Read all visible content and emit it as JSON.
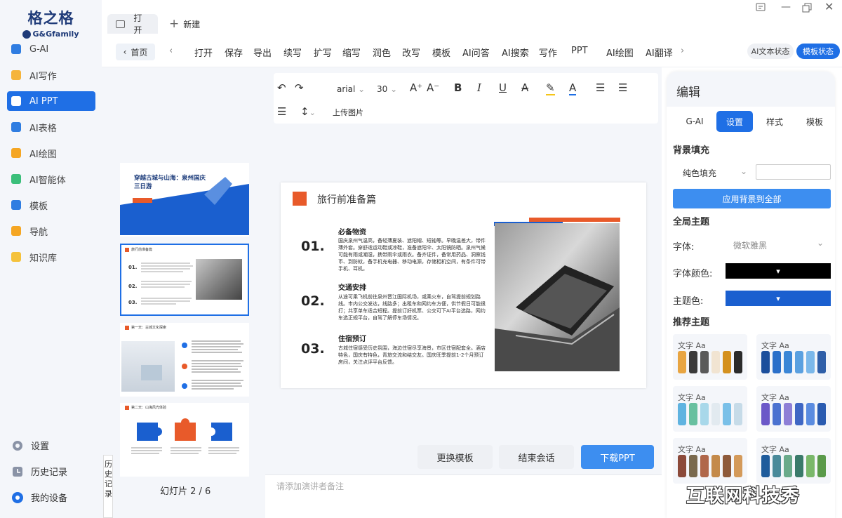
{
  "app": {
    "logo_cn": "格之格",
    "logo_en": "G&Gfamily"
  },
  "sidebar": {
    "items": [
      {
        "label": "G-AI",
        "color": "#2f7de1"
      },
      {
        "label": "AI写作",
        "color": "#f5b43b"
      },
      {
        "label": "AI PPT",
        "color": "#3bbf7a"
      },
      {
        "label": "AI表格",
        "color": "#2f7de1"
      },
      {
        "label": "AI绘图",
        "color": "#f5a623"
      },
      {
        "label": "AI智能体",
        "color": "#3bbf7a"
      },
      {
        "label": "模板",
        "color": "#2f7de1"
      },
      {
        "label": "导航",
        "color": "#f5a623"
      },
      {
        "label": "知识库",
        "color": "#f5c23b"
      }
    ],
    "bottom": {
      "settings": "设置",
      "history": "历史记录",
      "devices": "我的设备"
    }
  },
  "tabs": {
    "open": "打开",
    "new": "新建"
  },
  "toolbar": {
    "home": "首页",
    "items": [
      "打开",
      "保存",
      "导出",
      "续写",
      "扩写",
      "缩写",
      "润色",
      "改写",
      "模板",
      "AI问答",
      "AI搜索",
      "写作",
      "PPT",
      "AI绘图",
      "AI翻译"
    ],
    "status_text": "AI文本状态",
    "status_template": "模板状态"
  },
  "editor": {
    "font": "arial",
    "size": "30",
    "upload": "上传图片",
    "buttons": {
      "change": "更换模板",
      "end": "结束会话",
      "download": "下载PPT"
    },
    "notes_placeholder": "请添加演讲者备注"
  },
  "slides": {
    "counter": "幻灯片 2 / 6",
    "history_tab": "历史记录",
    "thumb1_title": "穿越古城与山海：泉州国庆三日游",
    "thumb2_title": "旅行前准备篇",
    "thumb3_title": "第一天：古城文化探索",
    "thumb4_title": "第二天：山海风光体验"
  },
  "slide": {
    "title": "旅行前准备篇",
    "sections": [
      {
        "num": "01.",
        "head": "必备物资",
        "body": "国庆泉州气温高，备轻薄夏装、遮阳帽、短袖等。早晚温差大，带件薄外套。穿舒适运动鞋或凉鞋，准备遮阳伞、太阳镜防晒。泉州气候可能有雨或潮湿，携带雨伞或雨衣。备齐证件，备常用药品、洞察钱币、到防蚊，备手机充电器、移动电源，存储相机空间，有条件可带手机、耳机。"
      },
      {
        "num": "02.",
        "head": "交通安排",
        "body": "从途可乘飞机前往泉州晋江国际机场，或乘火车，自驾提前规划路线。市内公交发达，线路多；出租车和网约车方便，供节假日可能很打；共享单车适合短程。提前订好机票、公交可下AI平台选路，网约车选正规平台，自驾了解停车场情况。"
      },
      {
        "num": "03.",
        "head": "住宿预订",
        "body": "古城住宿感受历史氛围，海边住宿尽享海景，市区住宿配套全。酒店特色，国庆有特色，青旅交流和结交友。国庆旺季提前1-2个月预订房间，关注点评平台反馈。"
      }
    ]
  },
  "panel": {
    "title": "编辑",
    "tabs": [
      "G-AI",
      "设置",
      "样式",
      "模板"
    ],
    "bg_fill": "背景填充",
    "fill_mode": "纯色填充",
    "apply_bg": "应用背景到全部",
    "global_theme": "全局主题",
    "font_label": "字体:",
    "font_value": "微软雅黑",
    "font_color_label": "字体颜色:",
    "font_color": "#000000",
    "theme_color_label": "主题色:",
    "theme_color": "#1a5fcf",
    "recommended": "推荐主题",
    "sample": "文字 Aa",
    "themes": [
      [
        "#e8a542",
        "#3a3a3a",
        "#5a5a5a",
        "#f1e4d2",
        "#d4911f",
        "#2b2b2b"
      ],
      [
        "#1c4f9c",
        "#2a6fc9",
        "#3a86d6",
        "#5aa0e0",
        "#7bb8ea",
        "#2f5fa8"
      ],
      [
        "#5fb3e0",
        "#68c0a0",
        "#a8d8ea",
        "#e2eaf0",
        "#7ac0e8",
        "#c6dbe8"
      ],
      [
        "#6b58c8",
        "#4b72d0",
        "#8e7fd6",
        "#3f67c4",
        "#5b8ce0",
        "#2a5bb0"
      ],
      [
        "#8c4a3a",
        "#7a6a4e",
        "#b0674a",
        "#c48a4a",
        "#8e5a3a",
        "#d49a5a"
      ],
      [
        "#1f5c9c",
        "#4a8a9a",
        "#6aaa8a",
        "#3a7a6a",
        "#7ab86a",
        "#5a9a4a"
      ]
    ]
  },
  "watermark": "互联网科技秀"
}
